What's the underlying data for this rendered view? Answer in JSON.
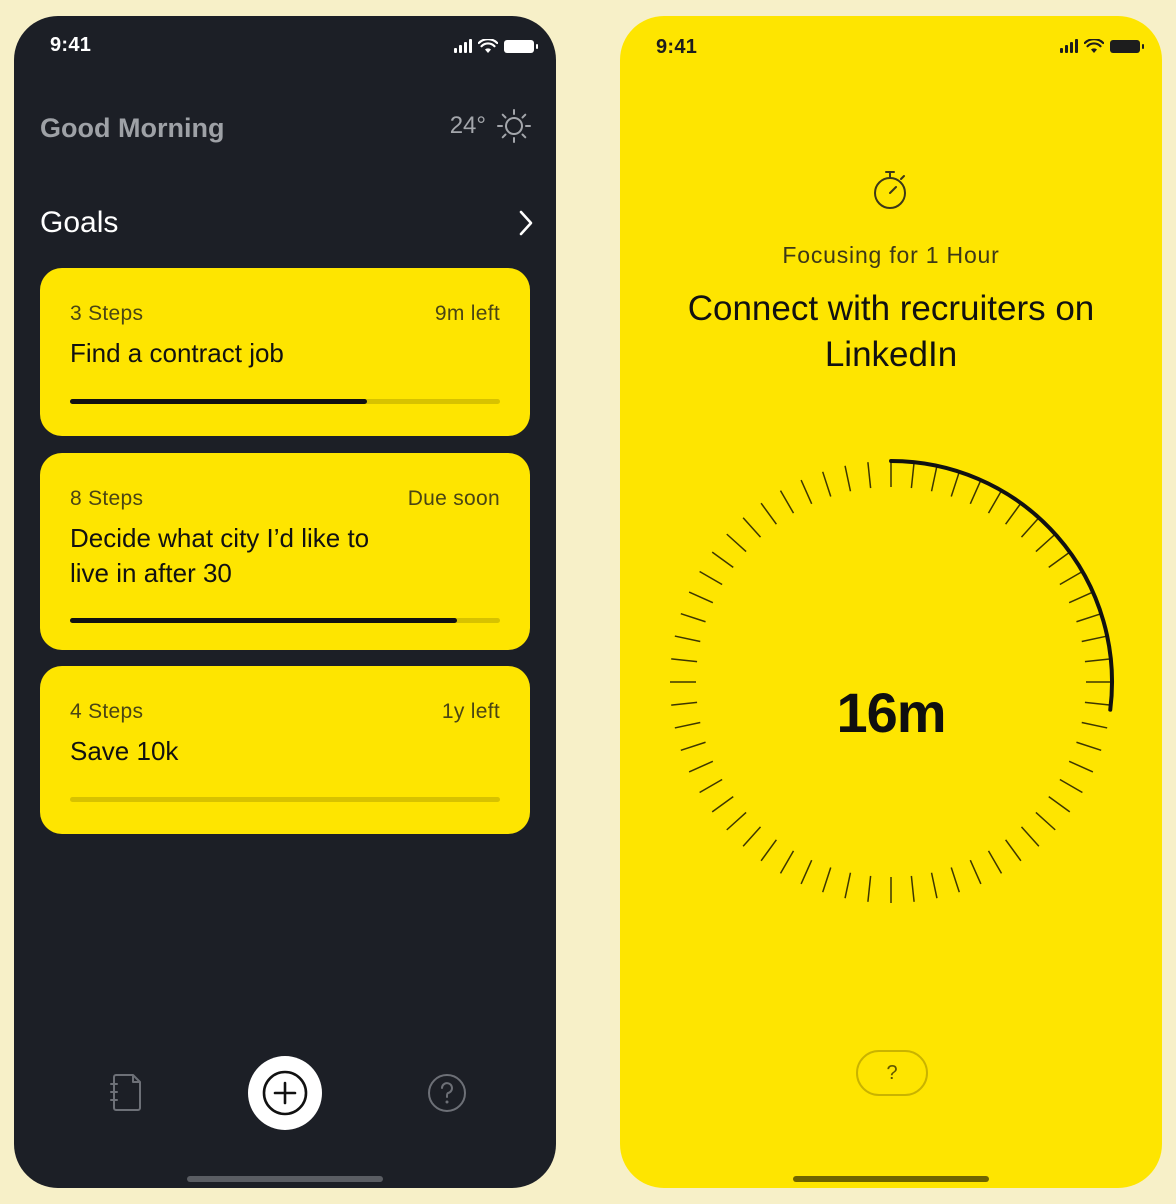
{
  "colors": {
    "background": "#f7f0c8",
    "dark_phone": "#1c1f26",
    "accent_yellow": "#fee500",
    "text_dark": "#111111"
  },
  "home_screen": {
    "status": {
      "time": "9:41"
    },
    "greeting": "Good Morning",
    "weather": {
      "temperature": "24°",
      "icon": "sun-icon"
    },
    "goals": {
      "title": "Goals",
      "items": [
        {
          "steps": "3 Steps",
          "due": "9m left",
          "title": "Find a contract job",
          "progress": 0.69
        },
        {
          "steps": "8 Steps",
          "due": "Due soon",
          "title": "Decide what city I’d like to live in after 30",
          "progress": 0.9
        },
        {
          "steps": "4 Steps",
          "due": "1y left",
          "title": "Save 10k",
          "progress": 0
        }
      ]
    },
    "nav": {
      "left_icon": "notebook-icon",
      "center_icon": "add-circle-icon",
      "right_icon": "help-circle-icon"
    }
  },
  "focus_screen": {
    "status": {
      "time": "9:41"
    },
    "timer_icon": "stopwatch-icon",
    "label": "Focusing for 1 Hour",
    "task": "Connect with recruiters on LinkedIn",
    "remaining": "16m",
    "remaining_fraction": 0.27,
    "help_label": "?"
  }
}
